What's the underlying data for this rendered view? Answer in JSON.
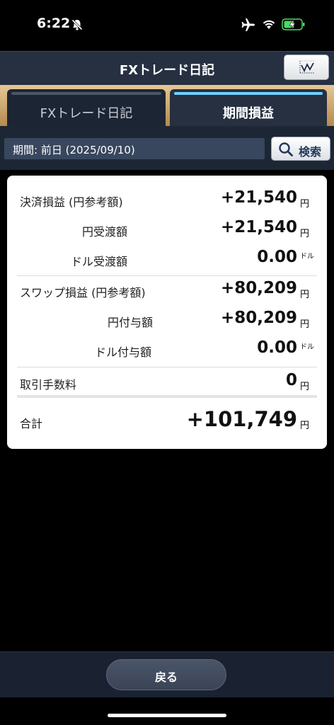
{
  "status_bar": {
    "time": "6:22",
    "icons": [
      "bell-slash-icon",
      "airplane-icon",
      "wifi-icon",
      "battery-charging-icon"
    ],
    "battery_color": "#4cd964"
  },
  "header": {
    "title": "FXトレード日記",
    "chart_button_icon": "line-chart-icon"
  },
  "tabs": [
    {
      "label": "FXトレード日記",
      "active": false
    },
    {
      "label": "期間損益",
      "active": true
    }
  ],
  "search": {
    "period": "期間: 前日 (2025/09/10)",
    "button_label": "検索",
    "button_icon": "search-icon"
  },
  "summary": {
    "rows": [
      {
        "label": "決済損益 (円参考額)",
        "value": "+21,540",
        "unit": "円"
      },
      {
        "label": "円受渡額",
        "value": "+21,540",
        "unit": "円"
      },
      {
        "label": "ドル受渡額",
        "value": "0.00",
        "unit": "ドル"
      },
      {
        "label": "スワップ損益 (円参考額)",
        "value": "+80,209",
        "unit": "円"
      },
      {
        "label": "円付与額",
        "value": "+80,209",
        "unit": "円"
      },
      {
        "label": "ドル付与額",
        "value": "0.00",
        "unit": "ドル"
      },
      {
        "label": "取引手数料",
        "value": "0",
        "unit": "円"
      }
    ],
    "total": {
      "label": "合計",
      "value": "+101,749",
      "unit": "円"
    }
  },
  "footer": {
    "back_label": "戻る"
  },
  "colors": {
    "navbar": "#263041",
    "tab_strip": "#c9a46a",
    "active_tab_indicator": "#6fd0ff",
    "card": "#ffffff"
  }
}
